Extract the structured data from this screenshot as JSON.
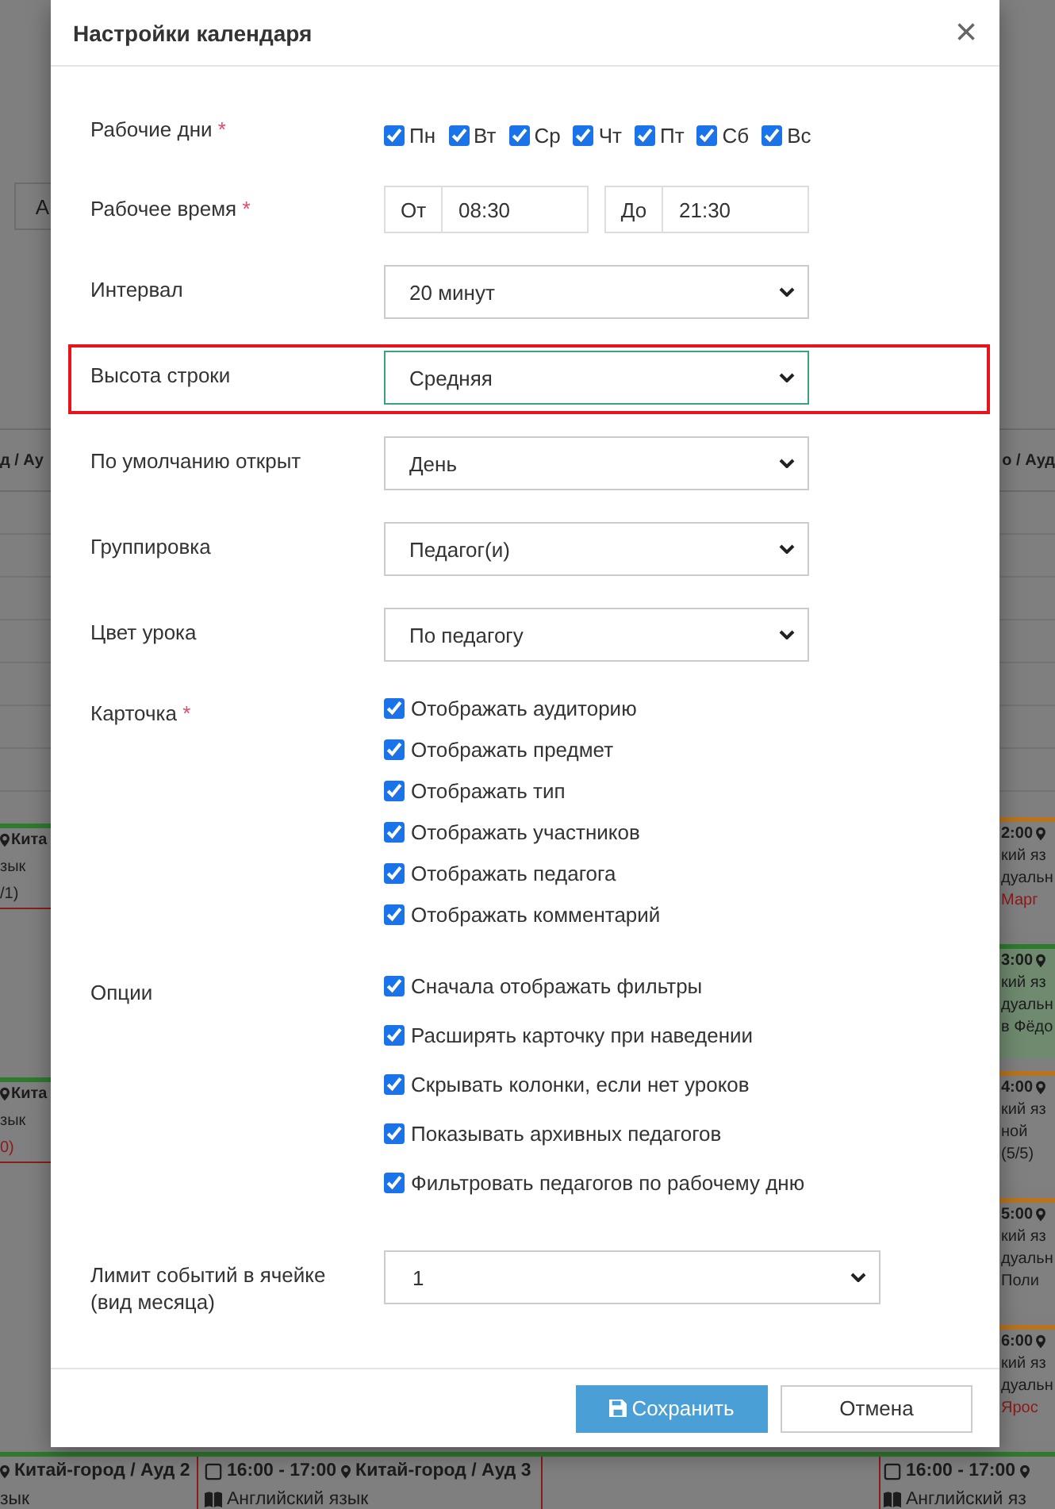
{
  "background": {
    "toolbar_button": "А",
    "column_headers": [
      "д / Ау",
      "о / Ауд"
    ],
    "rows": [
      {
        "left": {
          "place": "Кита",
          "subject": "зык",
          "count": "/1)",
          "count_alert": false
        },
        "right": {
          "time": "2:00",
          "subject": "кий яз",
          "type": "дуальн",
          "teacher": "Марг",
          "teacher_alert": true,
          "highlighted": false,
          "color": "#b8741c"
        }
      },
      {
        "right": {
          "time": "3:00",
          "subject": "кий яз",
          "type": "дуальн",
          "teacher": "в Фёдо",
          "teacher_alert": false,
          "highlighted": true,
          "color": "#2f7a2f"
        }
      },
      {
        "left": {
          "place": "Кита",
          "subject": "зык",
          "count": "0)",
          "count_alert": true
        },
        "right": {
          "time": "4:00",
          "subject": "кий яз",
          "type": "ной",
          "teacher": "(5/5)",
          "teacher_alert": false,
          "highlighted": false,
          "color": "#b8741c"
        }
      },
      {
        "right": {
          "time": "5:00",
          "subject": "кий яз",
          "type": "дуальн",
          "teacher": "Поли",
          "teacher_alert": false,
          "highlighted": false,
          "color": "#b8741c"
        }
      },
      {
        "right": {
          "time": "6:00",
          "subject": "кий яз",
          "type": "дуальн",
          "teacher": "Ярос",
          "teacher_alert": true,
          "highlighted": false,
          "color": "#b8741c"
        }
      }
    ],
    "bottom_row": [
      {
        "kind": "event",
        "place": "Китай-город / Ауд 2",
        "subject": "зык"
      },
      {
        "kind": "event",
        "time": "16:00 - 17:00",
        "place": "Китай-город / Ауд 3",
        "subject": "Английский язык"
      },
      {
        "kind": "empty"
      },
      {
        "kind": "event",
        "time": "16:00 - 17:00",
        "subject": "Английский яз"
      }
    ]
  },
  "modal": {
    "title": "Настройки календаря",
    "close": "×",
    "fields": [
      {
        "kind": "days",
        "label": "Рабочие дни",
        "required_mark": "*",
        "highlighted": false,
        "days": [
          {
            "label": "Пн",
            "checked": true
          },
          {
            "label": "Вт",
            "checked": true
          },
          {
            "label": "Ср",
            "checked": true
          },
          {
            "label": "Чт",
            "checked": true
          },
          {
            "label": "Пт",
            "checked": true
          },
          {
            "label": "Сб",
            "checked": true
          },
          {
            "label": "Вс",
            "checked": true
          }
        ]
      },
      {
        "kind": "time",
        "label": "Рабочее время",
        "required_mark": "*",
        "highlighted": false,
        "from": {
          "prefix": "От",
          "value": "08:30"
        },
        "to": {
          "prefix": "До",
          "value": "21:30"
        }
      },
      {
        "kind": "select",
        "label": "Интервал",
        "highlighted": false,
        "wide": false,
        "value": "20 минут"
      },
      {
        "kind": "select",
        "label": "Высота строки",
        "highlighted": true,
        "wide": false,
        "value": "Средняя"
      },
      {
        "kind": "select",
        "label": "По умолчанию открыт",
        "highlighted": false,
        "wide": false,
        "value": "День"
      },
      {
        "kind": "select",
        "label": "Группировка",
        "highlighted": false,
        "wide": false,
        "value": "Педагог(и)"
      },
      {
        "kind": "select",
        "label": "Цвет урока",
        "highlighted": false,
        "wide": false,
        "value": "По педагогу"
      },
      {
        "kind": "checklist",
        "label": "Карточка",
        "required_mark": "*",
        "highlighted": false,
        "options": [
          {
            "label": "Отображать аудиторию",
            "checked": true
          },
          {
            "label": "Отображать предмет",
            "checked": true
          },
          {
            "label": "Отображать тип",
            "checked": true
          },
          {
            "label": "Отображать участников",
            "checked": true
          },
          {
            "label": "Отображать педагога",
            "checked": true
          },
          {
            "label": "Отображать комментарий",
            "checked": true
          }
        ]
      },
      {
        "kind": "options",
        "label": "Опции",
        "highlighted": false,
        "options": [
          {
            "label": "Сначала отображать фильтры",
            "checked": true
          },
          {
            "label": "Расширять карточку при наведении",
            "checked": true
          },
          {
            "label": "Скрывать колонки, если нет уроков",
            "checked": true
          },
          {
            "label": "Показывать архивных педагогов",
            "checked": true
          },
          {
            "label": "Фильтровать педагогов по рабочему дню",
            "checked": true
          }
        ]
      },
      {
        "kind": "select",
        "label": "Лимит событий в ячейке (вид месяца)",
        "highlighted": false,
        "wide": true,
        "value": "1"
      }
    ],
    "buttons": [
      {
        "kind": "primary",
        "label": "Сохранить"
      },
      {
        "kind": "secondary",
        "label": "Отмена"
      }
    ]
  }
}
